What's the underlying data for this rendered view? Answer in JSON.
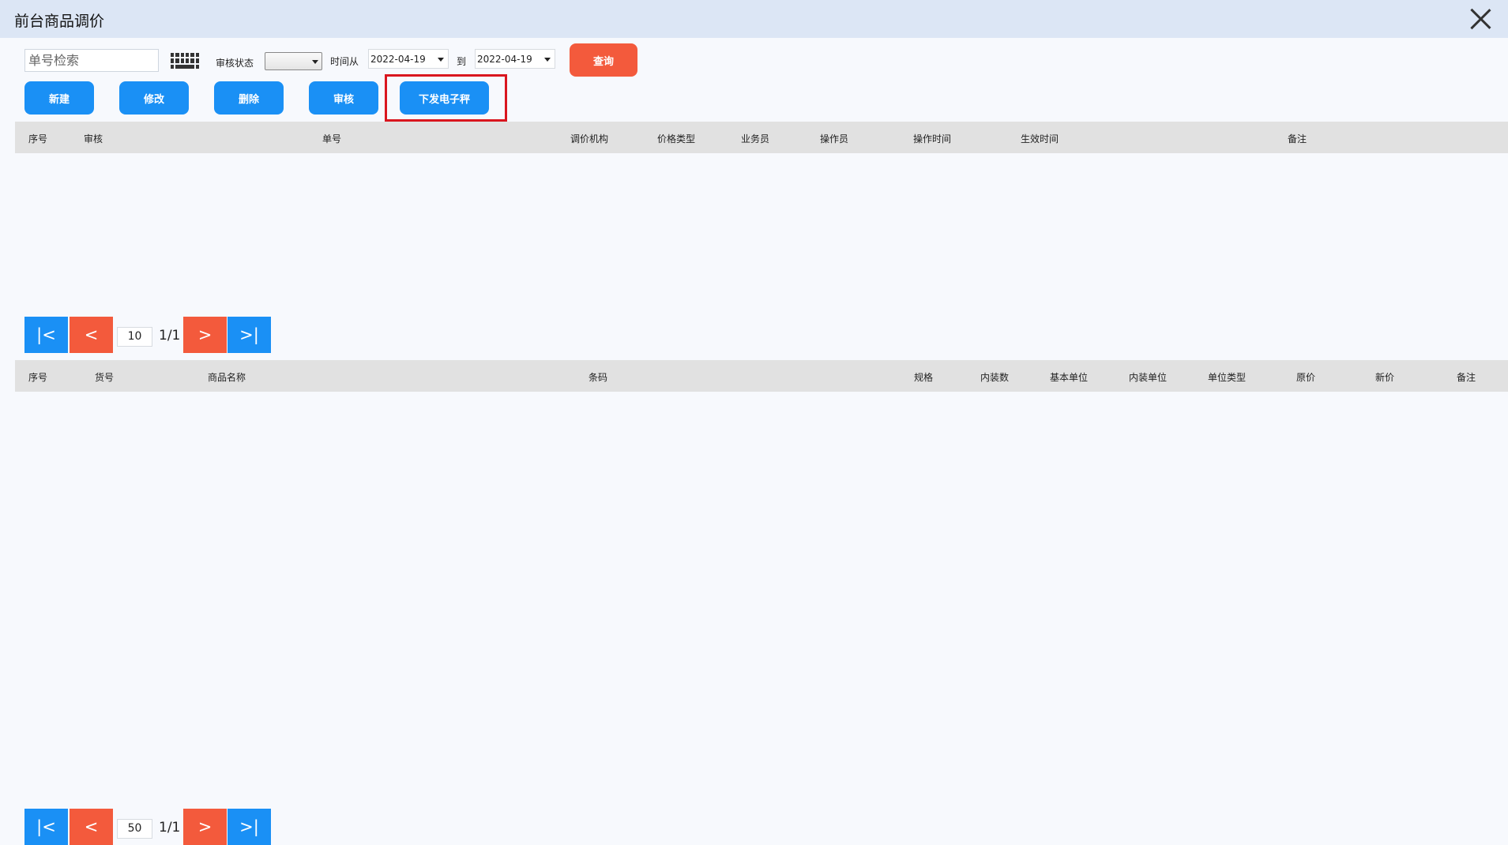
{
  "window": {
    "title": "前台商品调价"
  },
  "toolbar": {
    "search_placeholder": "单号检索",
    "status_label": "审核状态",
    "status_value": "",
    "time_from_label": "时间从",
    "date_from": "2022-04-19",
    "to_label": "到",
    "date_to": "2022-04-19",
    "query_label": "查询",
    "new_label": "新建",
    "edit_label": "修改",
    "delete_label": "删除",
    "audit_label": "审核",
    "send_scale_label": "下发电子秤"
  },
  "order_table": {
    "columns": [
      "序号",
      "审核",
      "单号",
      "调价机构",
      "价格类型",
      "业务员",
      "操作员",
      "操作时间",
      "生效时间",
      "备注"
    ],
    "rows": []
  },
  "order_pager": {
    "first": "|<",
    "prev": "<",
    "page_size": "10",
    "page_info": "1/1",
    "next": ">",
    "last": ">|"
  },
  "item_table": {
    "columns": [
      "序号",
      "货号",
      "商品名称",
      "条码",
      "规格",
      "内装数",
      "基本单位",
      "内装单位",
      "单位类型",
      "原价",
      "新价",
      "备注"
    ],
    "rows": []
  },
  "item_pager": {
    "first": "|<",
    "prev": "<",
    "page_size": "50",
    "page_info": "1/1",
    "next": ">",
    "last": ">|"
  },
  "colors": {
    "title_bar": "#dce6f5",
    "primary": "#1a90f5",
    "accent": "#f35a3c",
    "highlight": "#d9161f",
    "header_bg": "#e1e1e1"
  }
}
